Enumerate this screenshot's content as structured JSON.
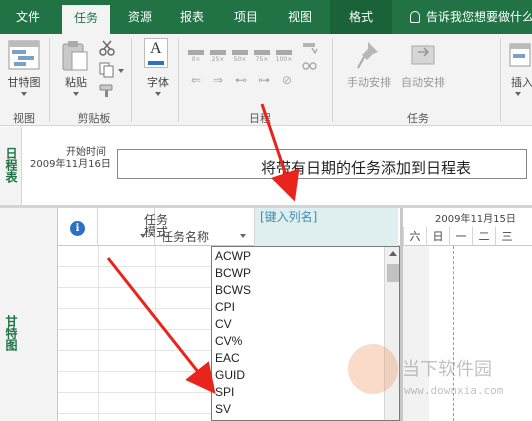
{
  "tabs": [
    {
      "label": "文件",
      "active": false
    },
    {
      "label": "任务",
      "active": true
    },
    {
      "label": "资源",
      "active": false
    },
    {
      "label": "报表",
      "active": false
    },
    {
      "label": "项目",
      "active": false
    },
    {
      "label": "视图",
      "active": false
    },
    {
      "label": "格式",
      "active": false,
      "contextual": true
    }
  ],
  "tell_me": "告诉我您想要做什么",
  "ribbon": {
    "groups": {
      "view": "视图",
      "clipboard": "剪贴板",
      "schedule": "日程",
      "tasks": "任务"
    },
    "buttons": {
      "gantt_chart": "甘特图",
      "paste": "粘贴",
      "font": "字体",
      "manual_schedule": "手动安排",
      "auto_schedule": "自动安排",
      "insert": "插入"
    },
    "percent_buttons": [
      "0×",
      "25×",
      "50×",
      "75×",
      "100×"
    ]
  },
  "timeline": {
    "side_label": "日程表",
    "start_label": "开始时间",
    "start_date": "2009年11月16日",
    "placeholder": "将带有日期的任务添加到日程表"
  },
  "gantt": {
    "side_label": "甘特图",
    "columns": {
      "info": "i",
      "mode": "任务模式",
      "name": "任务名称",
      "new_column": "[键入列名]"
    },
    "dropdown_items": [
      "ACWP",
      "BCWP",
      "BCWS",
      "CPI",
      "CV",
      "CV%",
      "EAC",
      "GUID",
      "SPI",
      "SV"
    ],
    "chart_header": {
      "date": "2009年11月15日",
      "days": [
        "六",
        "日",
        "一",
        "二",
        "三"
      ]
    }
  },
  "watermark": {
    "text": "当下软件园",
    "url": "www.downxia.com"
  },
  "colors": {
    "accent": "#217346",
    "new_column_bg": "#dfeff0",
    "arrow": "#e8241c"
  }
}
